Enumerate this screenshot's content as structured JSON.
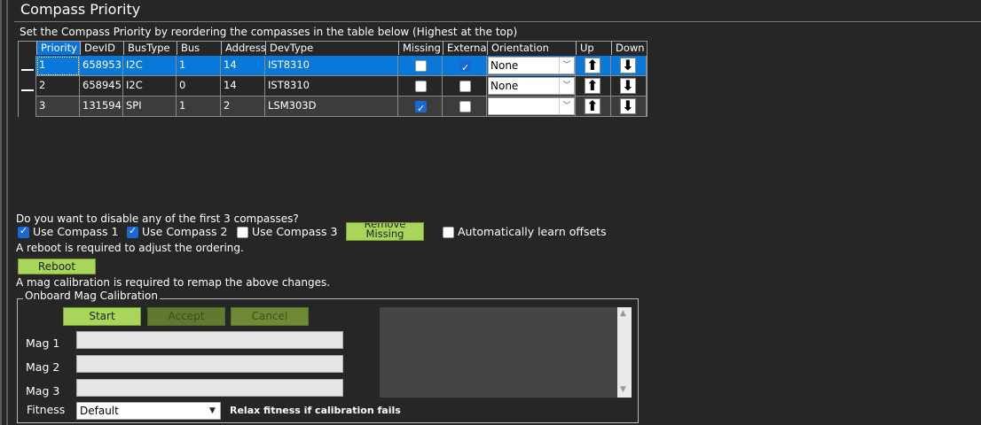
{
  "window": {
    "title": "Compass Priority"
  },
  "instructions": "Set the Compass Priority by reordering the compasses in the table below (Highest at the top)",
  "grid": {
    "headers": [
      "Priority",
      "DevID",
      "BusType",
      "Bus",
      "Address",
      "DevType",
      "Missing",
      "External",
      "Orientation",
      "Up",
      "Down"
    ],
    "rows": [
      {
        "priority": "1",
        "devid": "658953",
        "bustype": "I2C",
        "bus": "1",
        "address": "14",
        "devtype": "IST8310",
        "missing": false,
        "external": true,
        "orientation": "None"
      },
      {
        "priority": "2",
        "devid": "658945",
        "bustype": "I2C",
        "bus": "0",
        "address": "14",
        "devtype": "IST8310",
        "missing": false,
        "external": false,
        "orientation": "None"
      },
      {
        "priority": "3",
        "devid": "131594",
        "bustype": "SPI",
        "bus": "1",
        "address": "2",
        "devtype": "LSM303D",
        "missing": true,
        "external": false,
        "orientation": ""
      }
    ],
    "up_glyph": "⬆",
    "down_glyph": "⬇"
  },
  "disable_question": "Do you want to disable any of the first 3 compasses?",
  "compass_toggles": [
    {
      "label": "Use Compass 1",
      "checked": true
    },
    {
      "label": "Use Compass 2",
      "checked": true
    },
    {
      "label": "Use Compass 3",
      "checked": false
    }
  ],
  "remove_missing_label": "Remove Missing",
  "auto_learn": {
    "label": "Automatically learn offsets",
    "checked": false
  },
  "reboot_note": "A reboot is required to adjust the ordering.",
  "reboot_label": "Reboot",
  "mag_cal_note": "A mag calibration is required to remap the above changes.",
  "onboard_cal": {
    "legend": "Onboard Mag Calibration",
    "start_label": "Start",
    "accept_label": "Accept",
    "cancel_label": "Cancel",
    "mag_labels": [
      "Mag 1",
      "Mag 2",
      "Mag 3"
    ],
    "fitness_label": "Fitness",
    "fitness_value": "Default",
    "relax_label": "Relax fitness if calibration fails"
  },
  "colors": {
    "background": "#262626",
    "selection": "#0a78d8",
    "button_green": "#a8d55a"
  }
}
